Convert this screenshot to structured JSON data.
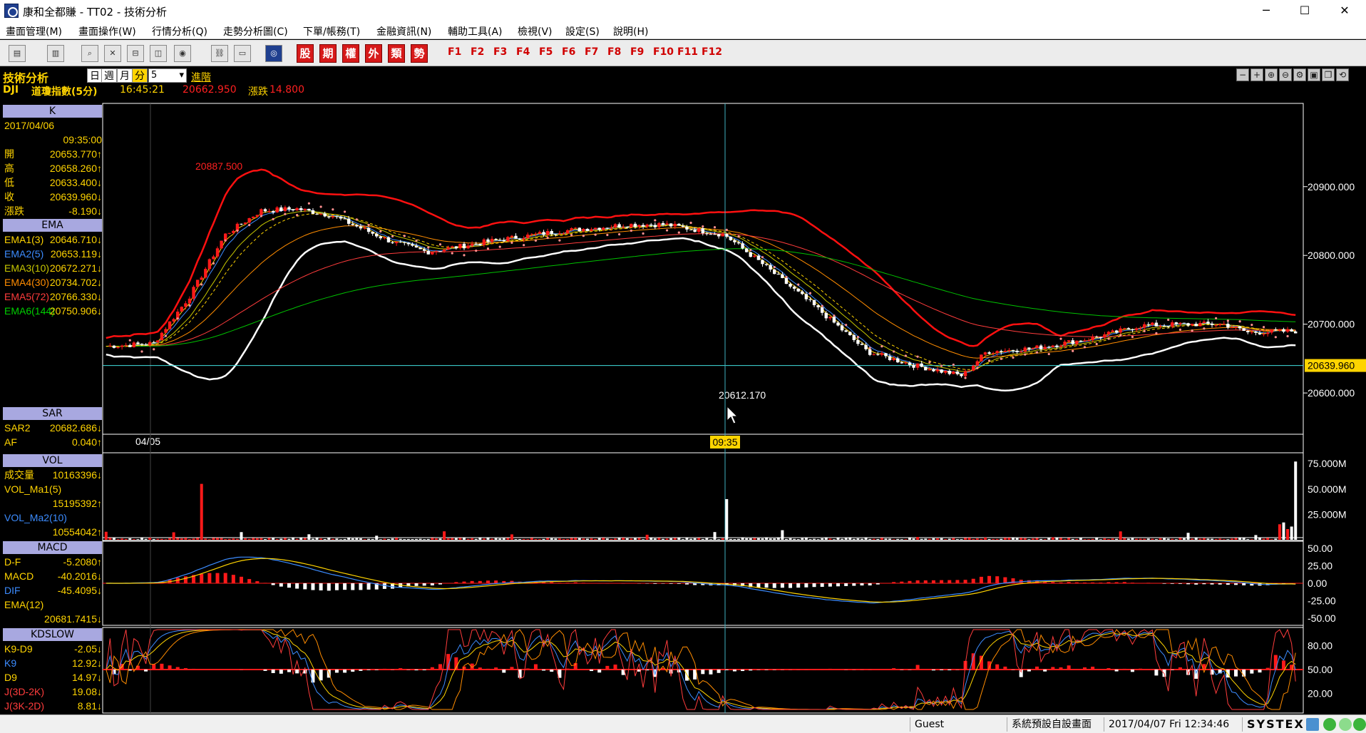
{
  "window": {
    "title": "康和全都賺 - TT02 - 技術分析",
    "minimize": "─",
    "maximize": "☐",
    "close": "✕"
  },
  "menu": [
    "畫面管理(M)",
    "畫面操作(W)",
    "行情分析(Q)",
    "走勢分析圖(C)",
    "下單/帳務(T)",
    "金融資訊(N)",
    "輔助工具(A)",
    "檢視(V)",
    "設定(S)",
    "說明(H)"
  ],
  "toolbar": {
    "red_buttons": [
      "股",
      "期",
      "權",
      "外",
      "類",
      "勢"
    ],
    "fkeys": [
      "F1",
      "F2",
      "F3",
      "F4",
      "F5",
      "F6",
      "F7",
      "F8",
      "F9",
      "F10",
      "F11",
      "F12"
    ]
  },
  "header": {
    "title": "技術分析",
    "periods": [
      "日",
      "週",
      "月",
      "分"
    ],
    "minutes": "5",
    "advanced": "進階",
    "symbol": "DJI",
    "symbol_name": "道瓊指數(5分)",
    "time": "16:45:21",
    "price": "20662.950",
    "change_label": "漲跌",
    "change": "14.800"
  },
  "panel": {
    "k_title": "K",
    "date": "2017/04/06",
    "time": "09:35:00",
    "ohlc": [
      {
        "label": "開",
        "value": "20653.770↑"
      },
      {
        "label": "高",
        "value": "20658.260↑"
      },
      {
        "label": "低",
        "value": "20633.400↓"
      },
      {
        "label": "收",
        "value": "20639.960↓"
      },
      {
        "label": "漲跌",
        "value": "-8.190↓"
      }
    ],
    "ema_title": "EMA",
    "emas": [
      {
        "label": "EMA1(3)",
        "value": "20646.710↓",
        "color": "#ffd400"
      },
      {
        "label": "EMA2(5)",
        "value": "20653.119↓",
        "color": "#3c8cff"
      },
      {
        "label": "EMA3(10)",
        "value": "20672.271↓",
        "color": "#c8c800"
      },
      {
        "label": "EMA4(30)",
        "value": "20734.702↓",
        "color": "#ff8c00"
      },
      {
        "label": "EMA5(72)",
        "value": "20766.330↓",
        "color": "#ff3c3c"
      },
      {
        "label": "EMA6(144)",
        "value": "20750.906↓",
        "color": "#00d000"
      }
    ],
    "sar_title": "SAR",
    "sar": [
      {
        "label": "SAR2",
        "value": "20682.686↓"
      },
      {
        "label": "AF",
        "value": "0.040↑"
      }
    ],
    "vol_title": "VOL",
    "vol": [
      {
        "label": "成交量",
        "value": "10163396↓",
        "color": "#ffd400"
      },
      {
        "label": "VOL_Ma1(5)",
        "value": "",
        "color": "#ffd400"
      },
      {
        "label": "",
        "value": "15195392↑",
        "color": "#ffd400"
      },
      {
        "label": "VOL_Ma2(10)",
        "value": "",
        "color": "#3c8cff"
      },
      {
        "label": "",
        "value": "10554042↑",
        "color": "#3c8cff"
      }
    ],
    "macd_title": "MACD",
    "macd": [
      {
        "label": "D-F",
        "value": "-5.2080↑",
        "color": "#ffd400"
      },
      {
        "label": "MACD",
        "value": "-40.2016↓",
        "color": "#ffd400"
      },
      {
        "label": "DIF",
        "value": "-45.4095↓",
        "color": "#3c8cff"
      },
      {
        "label": "EMA(12)",
        "value": "",
        "color": "#ffd400"
      },
      {
        "label": "",
        "value": "20681.7415↓",
        "color": "#ffd400"
      }
    ],
    "kd_title": "KDSLOW",
    "kd": [
      {
        "label": "K9-D9",
        "value": "-2.05↓",
        "color": "#ffd400"
      },
      {
        "label": "K9",
        "value": "12.92↓",
        "color": "#3c8cff"
      },
      {
        "label": "D9",
        "value": "14.97↓",
        "color": "#ffd400"
      },
      {
        "label": "J(3D-2K)",
        "value": "19.08↓",
        "color": "#ff3c3c"
      },
      {
        "label": "J(3K-2D)",
        "value": "8.81↓",
        "color": "#ff3c3c"
      }
    ]
  },
  "chart_labels": {
    "high_label": "20887.500",
    "low_label": "20612.170",
    "date_label": "04/05",
    "cursor_time": "09:35",
    "last_price": "20639.960"
  },
  "axes": {
    "price": [
      "20900.000",
      "20800.000",
      "20700.000",
      "20600.000"
    ],
    "volume": [
      "75.000M",
      "50.000M",
      "25.000M"
    ],
    "macd": [
      "50.00",
      "25.00",
      "0.00",
      "-25.00",
      "-50.00"
    ],
    "kd": [
      "80.00",
      "50.00",
      "20.00"
    ]
  },
  "status": {
    "user": "Guest",
    "layout": "系統預設自設畫面",
    "datetime": "2017/04/07 Fri 12:34:46",
    "brand": "SYSTEX"
  },
  "chart_data": {
    "type": "candlestick",
    "symbol": "DJI",
    "interval": "5min",
    "price_range": [
      20540,
      21020
    ],
    "cursor": {
      "time": "09:35",
      "close": 20639.96
    },
    "high_marker": 20887.5,
    "low_marker": 20612.17,
    "last": 20639.96
  }
}
